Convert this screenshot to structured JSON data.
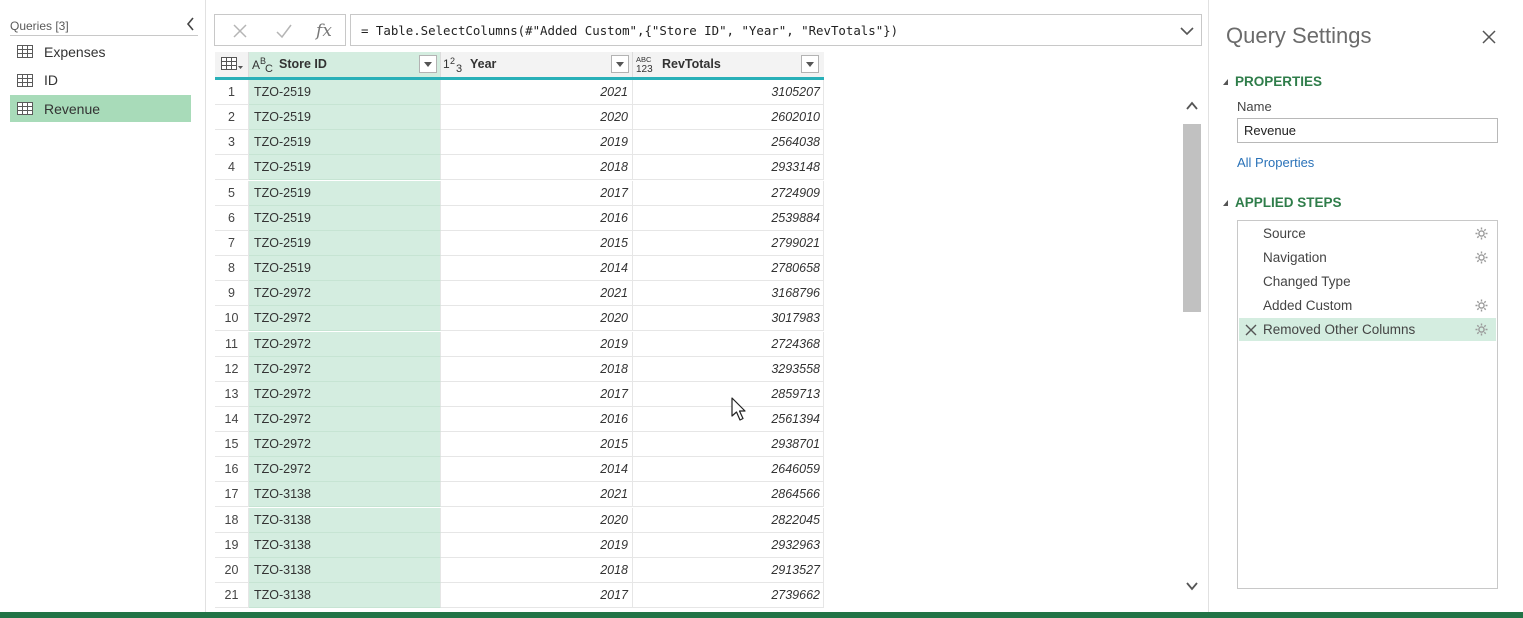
{
  "queries": {
    "title": "Queries [3]",
    "items": [
      {
        "label": "Expenses",
        "icon": "table-icon",
        "selected": false
      },
      {
        "label": "ID",
        "icon": "table-icon",
        "selected": false
      },
      {
        "label": "Revenue",
        "icon": "table-icon",
        "selected": true
      }
    ]
  },
  "formula_bar": {
    "cancel_icon": "close-icon",
    "commit_icon": "check-icon",
    "fx_label": "fx",
    "formula": "= Table.SelectColumns(#\"Added Custom\",{\"Store ID\", \"Year\", \"RevTotals\"})"
  },
  "grid": {
    "columns": [
      {
        "label": "Store ID",
        "type_icon": "text-type-icon",
        "type_text": "ABC"
      },
      {
        "label": "Year",
        "type_icon": "whole-number-type-icon",
        "type_text": "123"
      },
      {
        "label": "RevTotals",
        "type_icon": "any-type-icon",
        "type_text": "ABC 123"
      }
    ],
    "rows": [
      {
        "n": "1",
        "store": "TZO-2519",
        "year": "2021",
        "rev": "3105207"
      },
      {
        "n": "2",
        "store": "TZO-2519",
        "year": "2020",
        "rev": "2602010"
      },
      {
        "n": "3",
        "store": "TZO-2519",
        "year": "2019",
        "rev": "2564038"
      },
      {
        "n": "4",
        "store": "TZO-2519",
        "year": "2018",
        "rev": "2933148"
      },
      {
        "n": "5",
        "store": "TZO-2519",
        "year": "2017",
        "rev": "2724909"
      },
      {
        "n": "6",
        "store": "TZO-2519",
        "year": "2016",
        "rev": "2539884"
      },
      {
        "n": "7",
        "store": "TZO-2519",
        "year": "2015",
        "rev": "2799021"
      },
      {
        "n": "8",
        "store": "TZO-2519",
        "year": "2014",
        "rev": "2780658"
      },
      {
        "n": "9",
        "store": "TZO-2972",
        "year": "2021",
        "rev": "3168796"
      },
      {
        "n": "10",
        "store": "TZO-2972",
        "year": "2020",
        "rev": "3017983"
      },
      {
        "n": "11",
        "store": "TZO-2972",
        "year": "2019",
        "rev": "2724368"
      },
      {
        "n": "12",
        "store": "TZO-2972",
        "year": "2018",
        "rev": "3293558"
      },
      {
        "n": "13",
        "store": "TZO-2972",
        "year": "2017",
        "rev": "2859713"
      },
      {
        "n": "14",
        "store": "TZO-2972",
        "year": "2016",
        "rev": "2561394"
      },
      {
        "n": "15",
        "store": "TZO-2972",
        "year": "2015",
        "rev": "2938701"
      },
      {
        "n": "16",
        "store": "TZO-2972",
        "year": "2014",
        "rev": "2646059"
      },
      {
        "n": "17",
        "store": "TZO-3138",
        "year": "2021",
        "rev": "2864566"
      },
      {
        "n": "18",
        "store": "TZO-3138",
        "year": "2020",
        "rev": "2822045"
      },
      {
        "n": "19",
        "store": "TZO-3138",
        "year": "2019",
        "rev": "2932963"
      },
      {
        "n": "20",
        "store": "TZO-3138",
        "year": "2018",
        "rev": "2913527"
      },
      {
        "n": "21",
        "store": "TZO-3138",
        "year": "2017",
        "rev": "2739662"
      }
    ]
  },
  "settings": {
    "title": "Query Settings",
    "properties_label": "PROPERTIES",
    "name_label": "Name",
    "name_value": "Revenue",
    "all_properties_label": "All Properties",
    "applied_steps_label": "APPLIED STEPS",
    "steps": [
      {
        "label": "Source",
        "has_gear": true,
        "selected": false
      },
      {
        "label": "Navigation",
        "has_gear": true,
        "selected": false
      },
      {
        "label": "Changed Type",
        "has_gear": false,
        "selected": false
      },
      {
        "label": "Added Custom",
        "has_gear": true,
        "selected": false
      },
      {
        "label": "Removed Other Columns",
        "has_gear": true,
        "selected": true
      }
    ]
  },
  "colors": {
    "accent_green": "#217346",
    "selected_query": "#a8dbb9",
    "selected_column": "#d4ede0",
    "header_underline": "#29b0b8",
    "section_title": "#2f7d4a",
    "link": "#2a72b8"
  }
}
